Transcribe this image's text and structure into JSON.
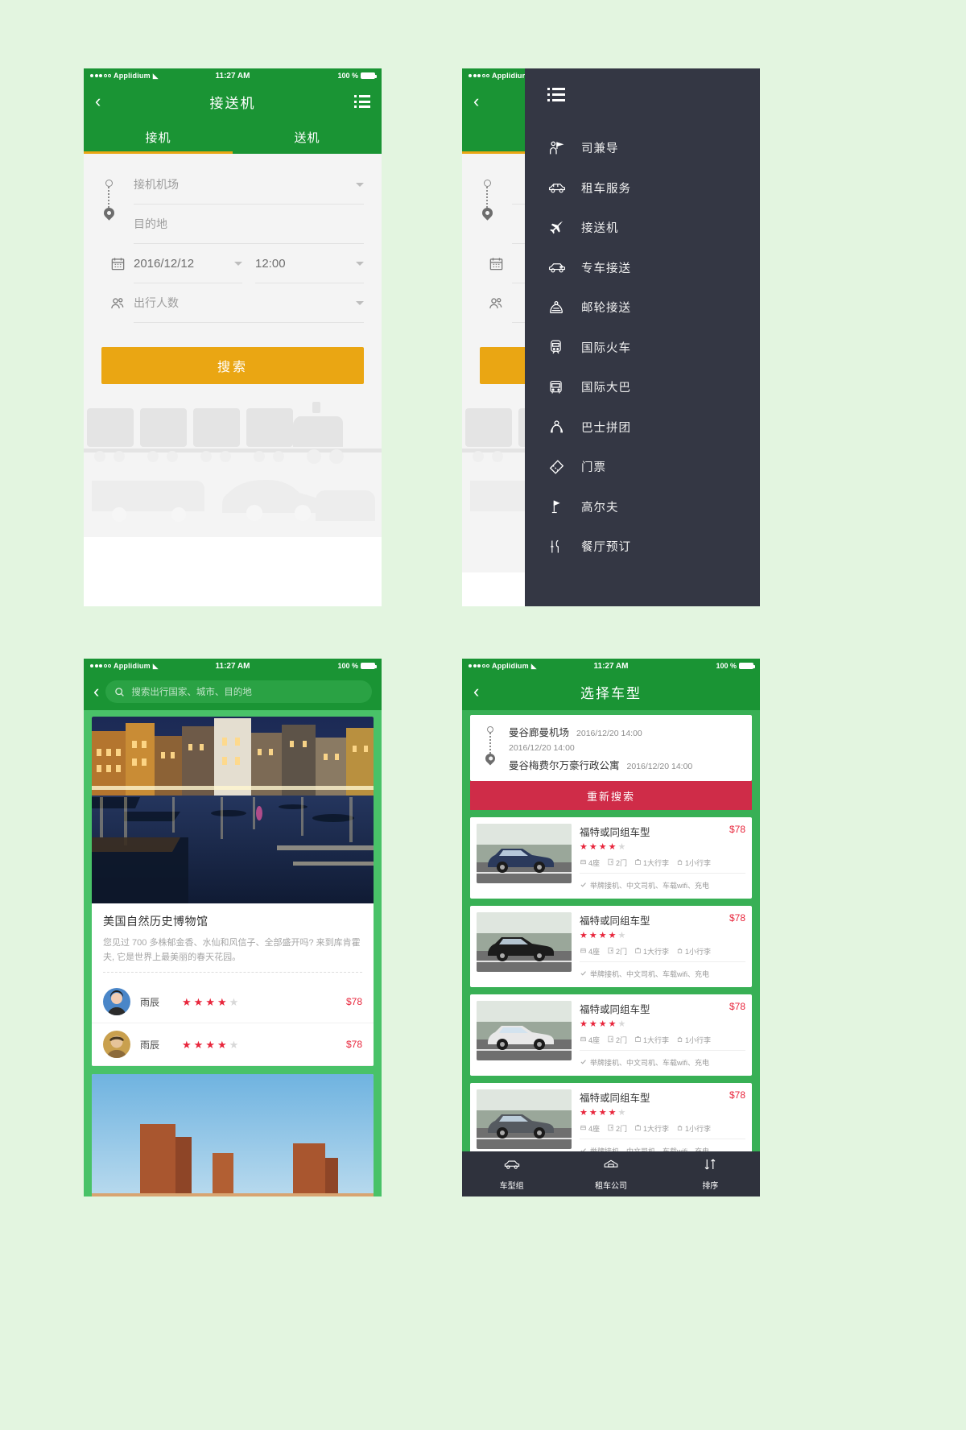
{
  "status_bar": {
    "carrier": "Applidium",
    "time": "11:27 AM",
    "battery": "100 %"
  },
  "screen1": {
    "title": "接送机",
    "back_icon": "chevron-left-icon",
    "menu_icon": "list-menu-icon",
    "tabs": [
      {
        "label": "接机",
        "active": true
      },
      {
        "label": "送机",
        "active": false
      }
    ],
    "form": {
      "pickup_airport_placeholder": "接机机场",
      "destination_placeholder": "目的地",
      "date_value": "2016/12/12",
      "time_value": "12:00",
      "passengers_placeholder": "出行人数"
    },
    "search_button": "搜索"
  },
  "screen2": {
    "drawer_icon": "list-menu-icon",
    "menu_items": [
      {
        "label": "司兼导",
        "icon": "guide-icon"
      },
      {
        "label": "租车服务",
        "icon": "car-rental-icon"
      },
      {
        "label": "接送机",
        "icon": "airplane-icon"
      },
      {
        "label": "专车接送",
        "icon": "private-car-icon"
      },
      {
        "label": "邮轮接送",
        "icon": "cruise-icon"
      },
      {
        "label": "国际火车",
        "icon": "train-icon"
      },
      {
        "label": "国际大巴",
        "icon": "bus-icon"
      },
      {
        "label": "巴士拼团",
        "icon": "group-bus-icon"
      },
      {
        "label": "门票",
        "icon": "ticket-icon"
      },
      {
        "label": "高尔夫",
        "icon": "golf-icon"
      },
      {
        "label": "餐厅预订",
        "icon": "restaurant-icon"
      }
    ]
  },
  "screen3": {
    "back_icon": "chevron-left-icon",
    "search_placeholder": "搜索出行国家、城市、目的地",
    "search_icon": "search-icon",
    "card": {
      "title": "美国自然历史博物馆",
      "description": "您见过 700 多株郁金香、水仙和风信子、全部盛开吗? 来到库肯霍夫, 它是世界上最美丽的春天花园。",
      "reviews": [
        {
          "name": "雨辰",
          "stars": 4,
          "max_stars": 5,
          "price": "$78"
        },
        {
          "name": "雨辰",
          "stars": 4,
          "max_stars": 5,
          "price": "$78"
        }
      ]
    }
  },
  "screen4": {
    "title": "选择车型",
    "back_icon": "chevron-left-icon",
    "trip": {
      "origin": "曼谷廊曼机场",
      "origin_datetime": "2016/12/20  14:00",
      "mid_datetime": "2016/12/20  14:00",
      "destination": "曼谷梅费尔万豪行政公寓",
      "destination_datetime": "2016/12/20  14:00"
    },
    "research_button": "重新搜索",
    "cars": [
      {
        "name": "福特或同组车型",
        "price": "$78",
        "stars": 4,
        "max_stars": 5,
        "specs": [
          "4座",
          "2门",
          "1大行李",
          "1小行李"
        ],
        "features": "举牌接机、中文司机、车载wifi、充电",
        "color": "#2b3a5c"
      },
      {
        "name": "福特或同组车型",
        "price": "$78",
        "stars": 4,
        "max_stars": 5,
        "specs": [
          "4座",
          "2门",
          "1大行李",
          "1小行李"
        ],
        "features": "举牌接机、中文司机、车载wifi、充电",
        "color": "#1c1c1c"
      },
      {
        "name": "福特或同组车型",
        "price": "$78",
        "stars": 4,
        "max_stars": 5,
        "specs": [
          "4座",
          "2门",
          "1大行李",
          "1小行李"
        ],
        "features": "举牌接机、中文司机、车载wifi、充电",
        "color": "#e8e8e8"
      },
      {
        "name": "福特或同组车型",
        "price": "$78",
        "stars": 4,
        "max_stars": 5,
        "specs": [
          "4座",
          "2门",
          "1大行李",
          "1小行李"
        ],
        "features": "举牌接机、中文司机、车载wifi、充电",
        "color": "#555a60"
      }
    ],
    "bottom_tabs": [
      {
        "label": "车型组",
        "icon": "car-group-icon"
      },
      {
        "label": "租车公司",
        "icon": "company-icon"
      },
      {
        "label": "排序",
        "icon": "sort-icon"
      }
    ]
  },
  "colors": {
    "green": "#1a9434",
    "light_green_bg": "#e3f5e0",
    "orange": "#eaa613",
    "red": "#cf2c48",
    "dark": "#343744",
    "star_red": "#e8263c"
  }
}
